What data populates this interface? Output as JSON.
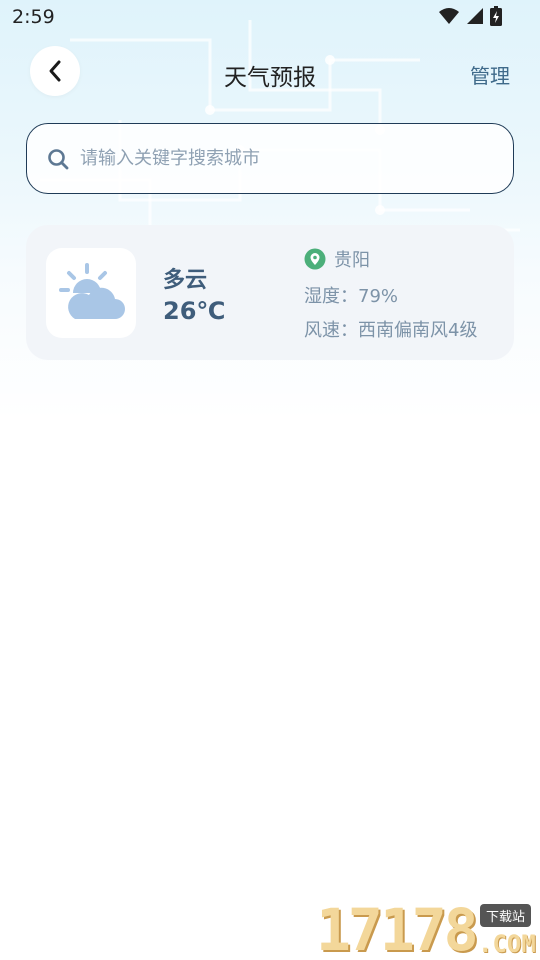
{
  "status_bar": {
    "time": "2:59",
    "icons": [
      "wifi-icon",
      "signal-icon",
      "battery-icon"
    ]
  },
  "header": {
    "title": "天气预报",
    "manage_label": "管理",
    "back_icon": "chevron-left-icon"
  },
  "search": {
    "placeholder": "请输入关键字搜索城市",
    "value": "",
    "icon": "search-icon"
  },
  "weather_card": {
    "icon": "partly-cloudy-icon",
    "condition": "多云",
    "temperature": "26℃",
    "city": "贵阳",
    "city_icon": "location-pin-icon",
    "humidity": "湿度：79%",
    "wind": "风速：西南偏南风4级"
  },
  "watermark": {
    "digits": "17178",
    "tag": "下载站",
    "suffix": ".COM"
  },
  "colors": {
    "accent_text": "#3f5d7b",
    "secondary_text": "#7d93a8",
    "manage_text": "#3f6a8a",
    "pin_green": "#4caf7a",
    "search_border": "#1f3b57",
    "card_bg": "#f2f5f9",
    "sky_top": "#dff3fb"
  }
}
